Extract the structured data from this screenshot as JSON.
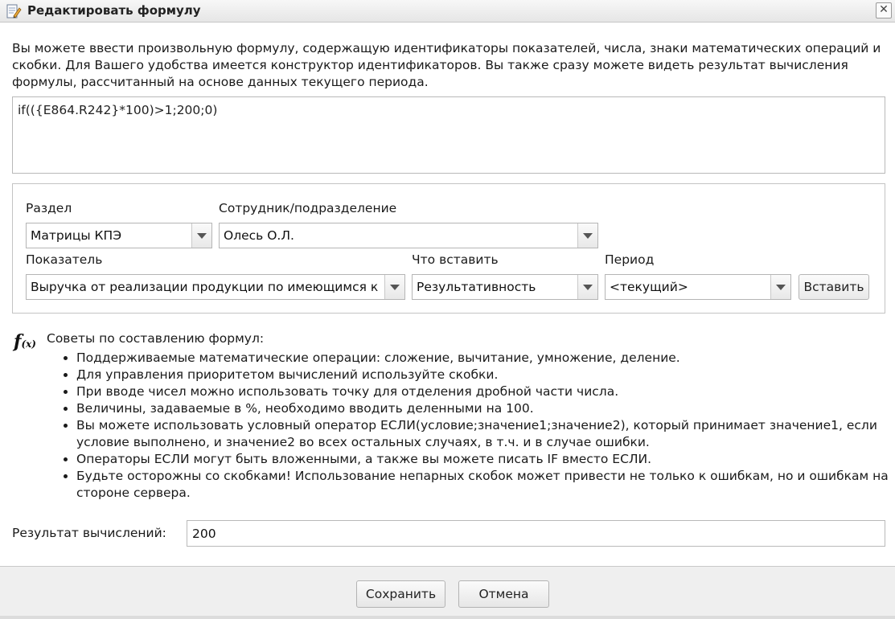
{
  "window": {
    "title": "Редактировать формулу",
    "title_icon": "edit-document-icon",
    "close_icon": "close-icon",
    "close_glyph": "✕"
  },
  "intro_text": "Вы можете ввести произвольную формулу, содержащую идентификаторы показателей, числа, знаки математических операций и скобки. Для Вашего удобства имеется конструктор идентификаторов. Вы также сразу можете видеть результат вычисления формулы, рассчитанный на основе данных текущего периода.",
  "formula_value": "if(({E864.R242}*100)>1;200;0)",
  "builder": {
    "section_label": "Раздел",
    "section_value": "Матрицы КПЭ",
    "employee_label": "Сотрудник/подразделение",
    "employee_value": "Олесь О.Л.",
    "indicator_label": "Показатель",
    "indicator_value": "Выручка от реализации продукции по имеющимся к",
    "insert_what_label": "Что вставить",
    "insert_what_value": "Результативность",
    "period_label": "Период",
    "period_value": "<текущий>",
    "insert_button": "Вставить"
  },
  "tips": {
    "icon": "function-fx-icon",
    "icon_f": "f",
    "icon_x": "(x)",
    "title": "Советы по составлению формул:",
    "items": [
      "Поддерживаемые математические операции: сложение, вычитание, умножение, деление.",
      "Для управления приоритетом вычислений используйте скобки.",
      "При вводе чисел можно использовать точку для отделения дробной части числа.",
      "Величины, задаваемые в %, необходимо вводить деленными на 100.",
      "Вы можете использовать условный оператор ЕСЛИ(условие;значение1;значение2), который принимает значение1, если условие выполнено, и значение2 во всех остальных случаях, в т.ч. и в случае ошибки.",
      "Операторы ЕСЛИ могут быть вложенными, а также вы можете писать IF вместо ЕСЛИ.",
      "Будьте осторожны со скобками! Использование непарных скобок может привести не только к ошибкам, но и ошибкам на стороне сервера."
    ]
  },
  "result": {
    "label": "Результат вычислений:",
    "value": "200"
  },
  "footer": {
    "save_label": "Сохранить",
    "cancel_label": "Отмена"
  },
  "colors": {
    "border": "#b9b9b9",
    "footer_bg": "#efefef",
    "titlebar_bg": "#e6e6e6"
  }
}
